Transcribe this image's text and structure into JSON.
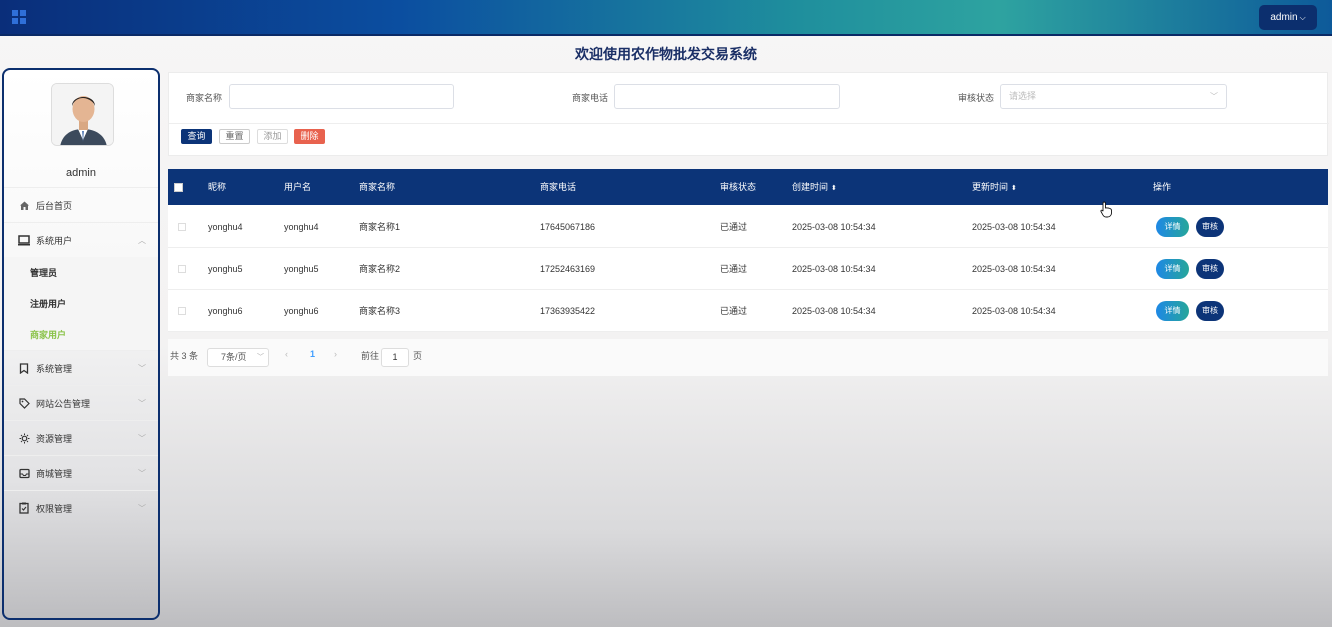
{
  "header": {
    "admin_label": "admin",
    "admin_caret": "⌵"
  },
  "page_title": "欢迎使用农作物批发交易系统",
  "sidebar": {
    "user_name": "admin",
    "items": [
      {
        "label": "后台首页",
        "icon": "home-icon"
      },
      {
        "label": "系统用户",
        "icon": "monitor-icon"
      },
      {
        "label": "系统管理",
        "icon": "bookmark-icon"
      },
      {
        "label": "网站公告管理",
        "icon": "tag-icon"
      },
      {
        "label": "资源管理",
        "icon": "sun-icon"
      },
      {
        "label": "商城管理",
        "icon": "inbox-icon"
      },
      {
        "label": "权限管理",
        "icon": "clipboard-icon"
      }
    ],
    "subitems": [
      {
        "label": "管理员"
      },
      {
        "label": "注册用户"
      },
      {
        "label": "商家用户",
        "active": true
      }
    ],
    "active_color": "#8bc34a"
  },
  "search": {
    "merchant_name_label": "商家名称",
    "merchant_name_value": "",
    "merchant_phone_label": "商家电话",
    "merchant_phone_value": "",
    "status_label": "审核状态",
    "status_placeholder": "请选择",
    "buttons": {
      "query": "查询",
      "reset": "重置",
      "add": "添加",
      "delete": "删除"
    }
  },
  "table": {
    "headers": {
      "nickname": "昵称",
      "username": "用户名",
      "merchant_name": "商家名称",
      "merchant_phone": "商家电话",
      "status": "审核状态",
      "created": "创建时间",
      "updated": "更新时间",
      "actions": "操作"
    },
    "rows": [
      {
        "nickname": "yonghu4",
        "username": "yonghu4",
        "merchant_name": "商家名称1",
        "merchant_phone": "17645067186",
        "status": "已通过",
        "created": "2025-03-08 10:54:34",
        "updated": "2025-03-08 10:54:34"
      },
      {
        "nickname": "yonghu5",
        "username": "yonghu5",
        "merchant_name": "商家名称2",
        "merchant_phone": "17252463169",
        "status": "已通过",
        "created": "2025-03-08 10:54:34",
        "updated": "2025-03-08 10:54:34"
      },
      {
        "nickname": "yonghu6",
        "username": "yonghu6",
        "merchant_name": "商家名称3",
        "merchant_phone": "17363935422",
        "status": "已通过",
        "created": "2025-03-08 10:54:34",
        "updated": "2025-03-08 10:54:34"
      }
    ],
    "detail_label": "详情",
    "audit_label": "审核"
  },
  "pagination": {
    "total": "共 3 条",
    "page_size": "7条/页",
    "prev": "‹",
    "current_page": "1",
    "next": "›",
    "goto_label": "前往",
    "goto_value": "1",
    "page_suffix": "页"
  },
  "colors": {
    "primary": "#0c3478",
    "danger": "#e8624e",
    "active_submenu": "#8bc34a"
  }
}
